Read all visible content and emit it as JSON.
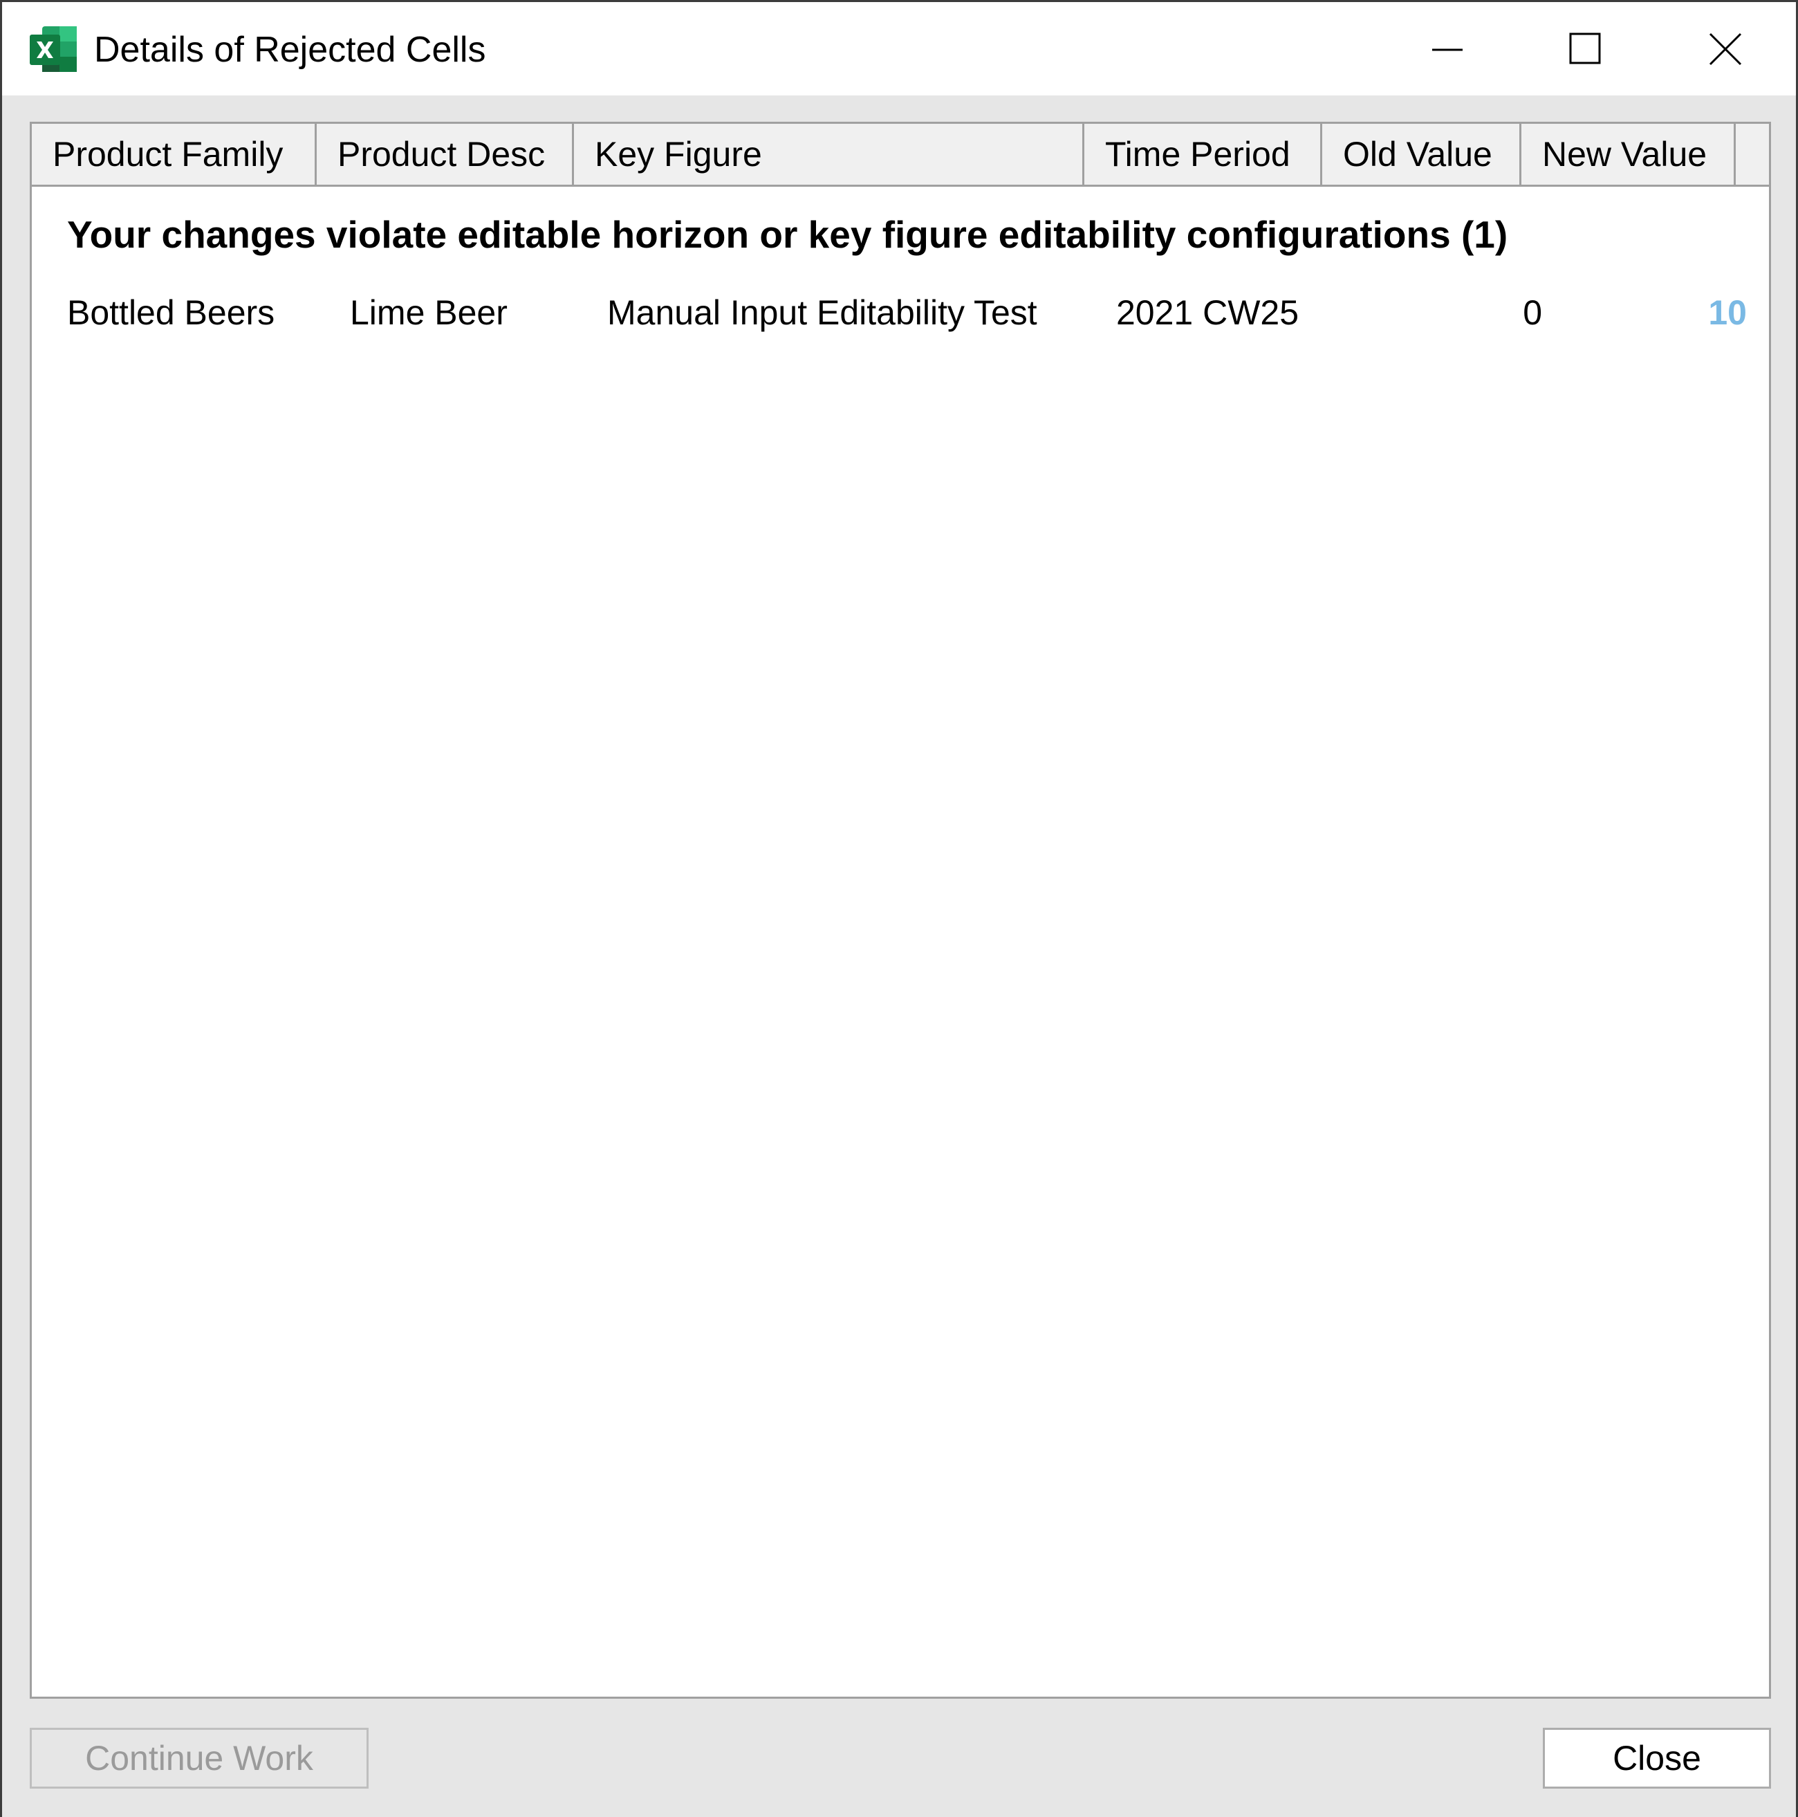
{
  "window": {
    "title": "Details of Rejected Cells",
    "app_icon": "excel-icon",
    "controls": {
      "minimize": "minimize-icon",
      "maximize": "maximize-icon",
      "close": "close-icon"
    }
  },
  "table": {
    "columns": [
      {
        "label": "Product Family"
      },
      {
        "label": "Product Desc"
      },
      {
        "label": "Key Figure"
      },
      {
        "label": "Time Period"
      },
      {
        "label": "Old Value"
      },
      {
        "label": "New Value"
      }
    ],
    "group_header": "Your changes violate editable horizon or key figure editability configurations (1)",
    "rows": [
      {
        "product_family": "Bottled Beers",
        "product_desc": "Lime Beer",
        "key_figure": "Manual Input Editability Test",
        "time_period": "2021 CW25",
        "old_value": "0",
        "new_value": "10"
      }
    ]
  },
  "buttons": {
    "continue_work": "Continue Work",
    "close": "Close"
  },
  "colors": {
    "new_value_text": "#7ab9e4",
    "excel_green": "#1e7145"
  }
}
